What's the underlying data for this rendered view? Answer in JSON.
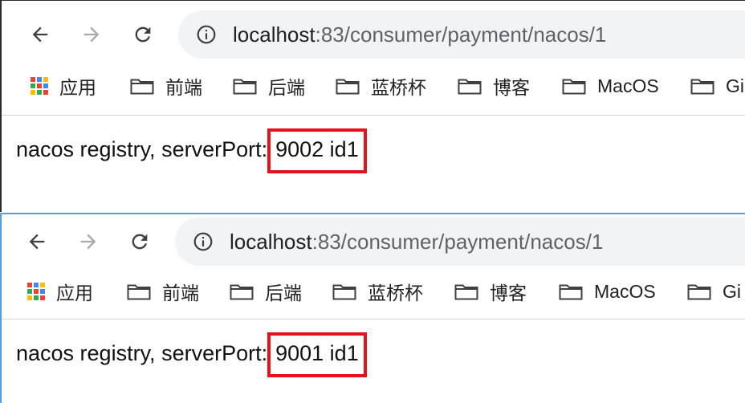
{
  "browsers": [
    {
      "url_host": "localhost",
      "url_path": ":83/consumer/payment/nacos/1",
      "content_prefix": "nacos registry, serverPort:",
      "content_result": "9002 id1"
    },
    {
      "url_host": "localhost",
      "url_path": ":83/consumer/payment/nacos/1",
      "content_prefix": "nacos registry, serverPort:",
      "content_result": "9001 id1"
    }
  ],
  "bookmarks": {
    "apps": "应用",
    "items": [
      "前端",
      "后端",
      "蓝桥杯",
      "博客",
      "MacOS",
      "Gi"
    ]
  },
  "icons": {
    "back": "arrow-left-icon",
    "forward": "arrow-right-icon",
    "reload": "reload-icon",
    "info": "info-icon",
    "apps": "apps-grid-icon",
    "folder": "folder-icon"
  },
  "colors": {
    "highlight_box": "#e8101b",
    "omnibox_bg": "#f1f3f4",
    "second_window_border": "#5a9fd4"
  }
}
